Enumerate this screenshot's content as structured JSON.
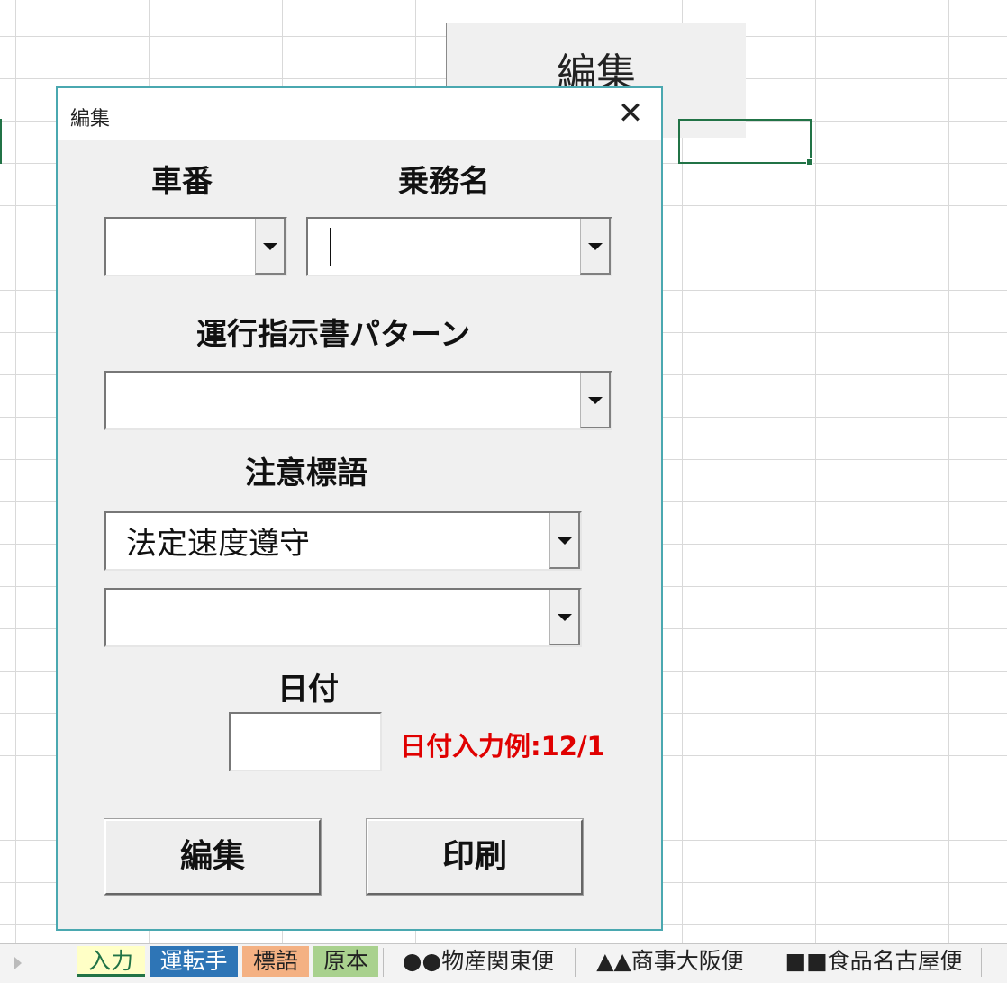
{
  "sheet": {
    "button_label": "編集"
  },
  "dialog": {
    "title": "編集",
    "close_glyph": "✕",
    "labels": {
      "car_number": "車番",
      "crew_name": "乗務名",
      "instruction_pattern": "運行指示書パターン",
      "caution_slogan": "注意標語",
      "date": "日付"
    },
    "fields": {
      "car_number_value": "",
      "crew_name_value": "",
      "instruction_pattern_value": "",
      "slogan_1_value": "法定速度遵守",
      "slogan_2_value": "",
      "date_value": ""
    },
    "date_hint": "日付入力例:12/1",
    "buttons": {
      "edit": "編集",
      "print": "印刷"
    }
  },
  "tabs": [
    {
      "label": "入力",
      "color": "#ffffc6",
      "active": true
    },
    {
      "label": "運転手",
      "color": "#2e75b6"
    },
    {
      "label": "標語",
      "color": "#f4b183"
    },
    {
      "label": "原本",
      "color": "#a9d18e"
    },
    {
      "label": "●●物産関東便"
    },
    {
      "label": "▲▲商事大阪便"
    },
    {
      "label": "■■食品名古屋便"
    }
  ],
  "colors": {
    "accent": "#217346",
    "dialog_border": "#4aa8b0",
    "hint": "#e00000"
  }
}
